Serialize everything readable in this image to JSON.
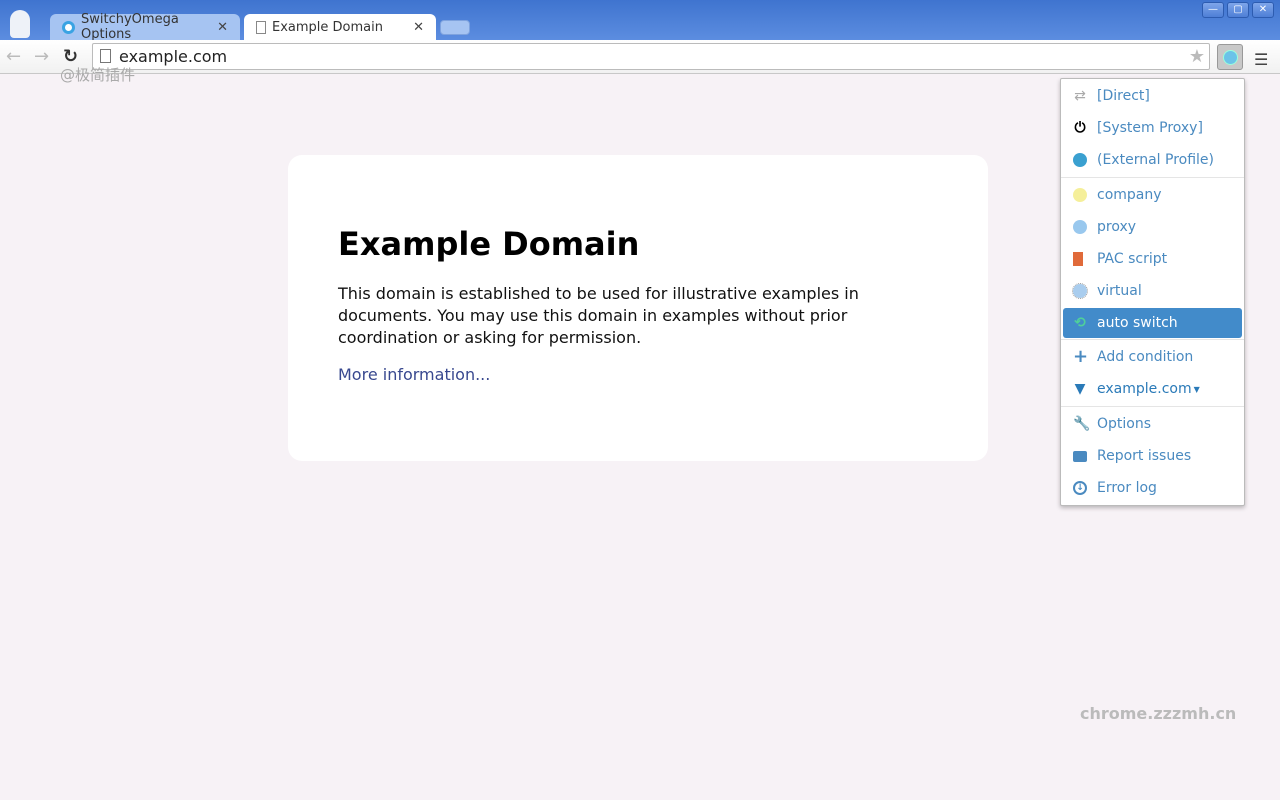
{
  "tabs": [
    {
      "label": "SwitchyOmega Options",
      "active": false
    },
    {
      "label": "Example Domain",
      "active": true
    }
  ],
  "address": {
    "value": "example.com"
  },
  "watermarks": {
    "top": "@极简插件",
    "bottom": "chrome.zzzmh.cn"
  },
  "page": {
    "title": "Example Domain",
    "para": "This domain is established to be used for illustrative examples in documents. You may use this domain in examples without prior coordination or asking for permission.",
    "link": "More information..."
  },
  "popup": {
    "builtin": [
      {
        "label": "[Direct]",
        "icon": "arrows-exchange-icon"
      },
      {
        "label": "[System Proxy]",
        "icon": "power-icon"
      },
      {
        "label": "(External Profile)",
        "icon": "globe-icon"
      }
    ],
    "profiles": [
      {
        "label": "company",
        "icon": "globe-icon",
        "color": "#f5ef9a"
      },
      {
        "label": "proxy",
        "icon": "globe-icon",
        "color": "#99c8ee"
      },
      {
        "label": "PAC script",
        "icon": "file-icon",
        "color": "#e06a3a"
      },
      {
        "label": "virtual",
        "icon": "globe-icon",
        "color": "#a9cdee"
      },
      {
        "label": "auto switch",
        "icon": "retweet-icon",
        "color": "#4fd09a",
        "selected": true
      }
    ],
    "conditions": [
      {
        "label": "Add condition",
        "icon": "plus-icon"
      },
      {
        "label": "example.com",
        "icon": "filter-icon"
      }
    ],
    "footer": [
      {
        "label": "Options",
        "icon": "wrench-icon"
      },
      {
        "label": "Report issues",
        "icon": "comment-icon"
      },
      {
        "label": "Error log",
        "icon": "download-icon"
      }
    ]
  },
  "colors": {
    "accent": "#428bca",
    "link": "#4a8ac0"
  }
}
